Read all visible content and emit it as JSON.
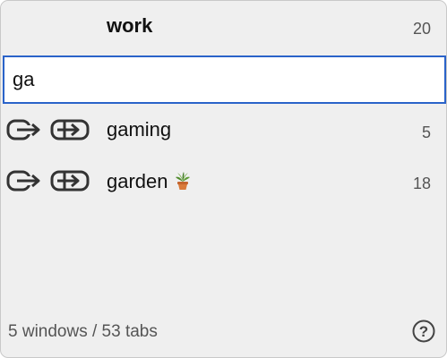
{
  "header": {
    "title": "work",
    "tab_count": "20"
  },
  "search": {
    "value": "ga",
    "placeholder": ""
  },
  "results": [
    {
      "label": "gaming",
      "emoji": "",
      "tab_count": "5"
    },
    {
      "label": "garden",
      "emoji": "potted-plant",
      "tab_count": "18"
    }
  ],
  "footer": {
    "summary": "5 windows / 53 tabs",
    "help_icon": "question-circle-icon"
  },
  "icons": {
    "open_here": "arrow-out-of-box-icon",
    "open_new": "arrow-into-box-icon"
  },
  "colors": {
    "focus_ring": "#2a63c9",
    "panel_bg": "#efefef"
  }
}
